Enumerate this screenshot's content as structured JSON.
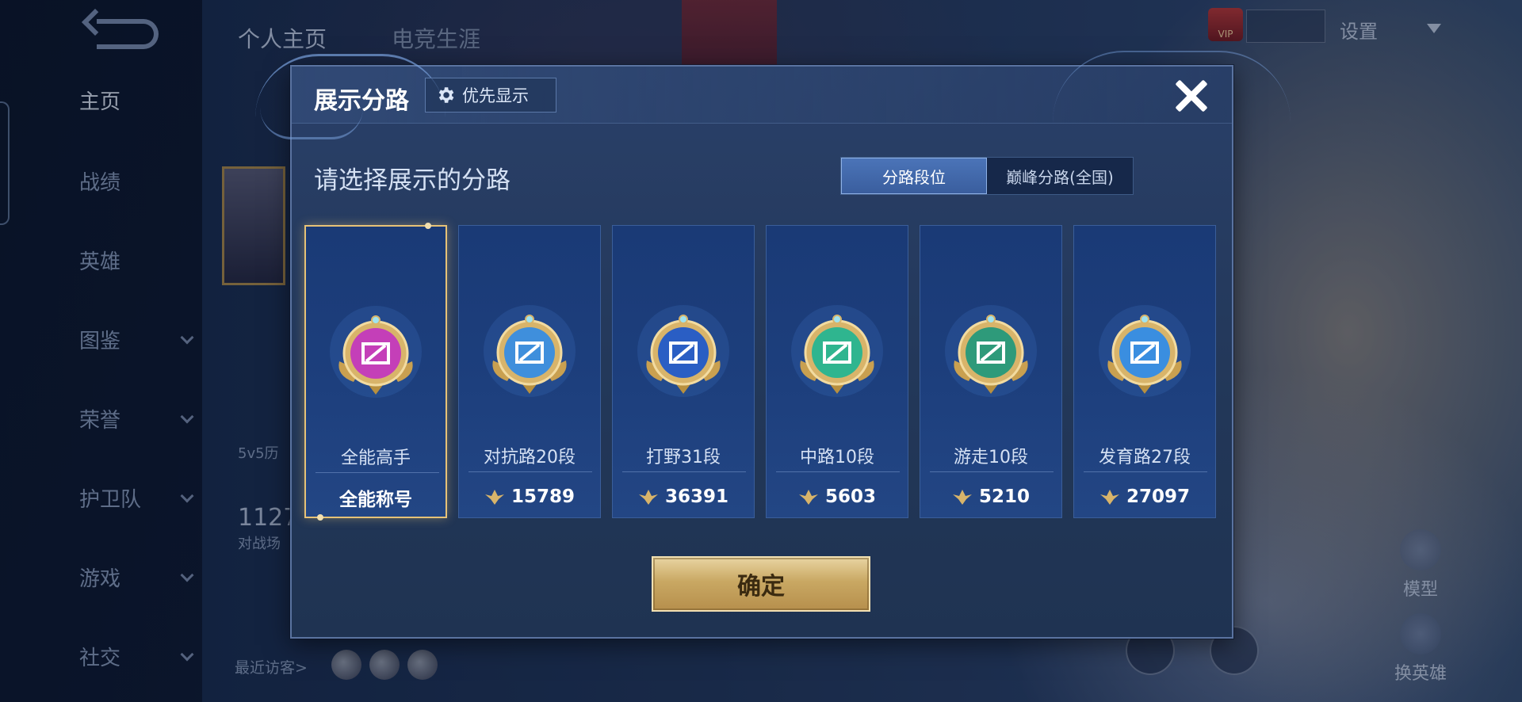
{
  "background": {
    "top_tabs": [
      "个人主页",
      "电竞生涯"
    ],
    "settings_label": "设置",
    "vip_label": "VIP",
    "nav_items": [
      {
        "label": "主页",
        "active": true,
        "has_chevron": false
      },
      {
        "label": "战绩",
        "active": false,
        "has_chevron": false
      },
      {
        "label": "英雄",
        "active": false,
        "has_chevron": false
      },
      {
        "label": "图鉴",
        "active": false,
        "has_chevron": true
      },
      {
        "label": "荣誉",
        "active": false,
        "has_chevron": true
      },
      {
        "label": "护卫队",
        "active": false,
        "has_chevron": true
      },
      {
        "label": "游戏",
        "active": false,
        "has_chevron": true
      },
      {
        "label": "社交",
        "active": false,
        "has_chevron": true
      }
    ],
    "left_panel_texts": [
      "5v5历",
      "对战场"
    ],
    "big_number": "1127",
    "recent_visitors_label": "最近访客>",
    "right_buttons": [
      "模型",
      "换英雄"
    ]
  },
  "dialog": {
    "title": "展示分路",
    "priority_button_label": "优先显示",
    "prompt": "请选择展示的分路",
    "segment_tabs": [
      {
        "label": "分路段位",
        "active": true
      },
      {
        "label": "巅峰分路(全国)",
        "active": false
      }
    ],
    "cards": [
      {
        "title": "全能高手",
        "value": "全能称号",
        "show_icon": false,
        "selected": true,
        "emblem": "all-round-emblem-icon",
        "color": "#c43fb8"
      },
      {
        "title": "对抗路20段",
        "value": "15789",
        "show_icon": true,
        "selected": false,
        "emblem": "clash-lane-emblem-icon",
        "color": "#3f8fdc"
      },
      {
        "title": "打野31段",
        "value": "36391",
        "show_icon": true,
        "selected": false,
        "emblem": "jungle-emblem-icon",
        "color": "#2a5ec4"
      },
      {
        "title": "中路10段",
        "value": "5603",
        "show_icon": true,
        "selected": false,
        "emblem": "mid-lane-emblem-icon",
        "color": "#2fb58f"
      },
      {
        "title": "游走10段",
        "value": "5210",
        "show_icon": true,
        "selected": false,
        "emblem": "roam-emblem-icon",
        "color": "#2e9a7a"
      },
      {
        "title": "发育路27段",
        "value": "27097",
        "show_icon": true,
        "selected": false,
        "emblem": "farm-lane-emblem-icon",
        "color": "#3a8ee0"
      }
    ],
    "confirm_label": "确定"
  }
}
